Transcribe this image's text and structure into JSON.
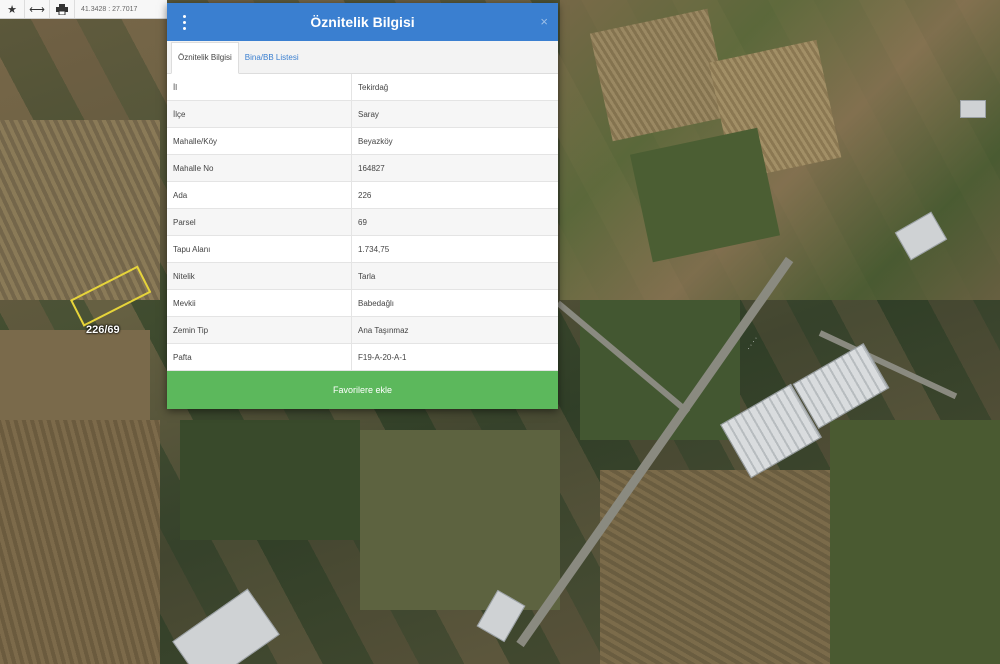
{
  "toolbar": {
    "icons": [
      "star-icon",
      "measure-icon",
      "print-icon"
    ],
    "coordinates": "41.3428 : 27.7017"
  },
  "dialog": {
    "title": "Öznitelik Bilgisi",
    "close_glyph": "×",
    "tabs": [
      {
        "label": "Öznitelik Bilgisi",
        "active": true
      },
      {
        "label": "Bina/BB Listesi",
        "active": false
      }
    ],
    "rows": [
      {
        "key": "İl",
        "value": "Tekirdağ"
      },
      {
        "key": "İlçe",
        "value": "Saray"
      },
      {
        "key": "Mahalle/Köy",
        "value": "Beyazköy"
      },
      {
        "key": "Mahalle No",
        "value": "164827"
      },
      {
        "key": "Ada",
        "value": "226"
      },
      {
        "key": "Parsel",
        "value": "69"
      },
      {
        "key": "Tapu Alanı",
        "value": "1.734,75"
      },
      {
        "key": "Nitelik",
        "value": "Tarla"
      },
      {
        "key": "Mevkii",
        "value": "Babedağlı"
      },
      {
        "key": "Zemin Tip",
        "value": "Ana Taşınmaz"
      },
      {
        "key": "Pafta",
        "value": "F19-A-20-A-1"
      }
    ],
    "favorite_button": "Favorilere ekle"
  },
  "map": {
    "parcel_label": "226/69"
  },
  "colors": {
    "header": "#3a7fd0",
    "favorite_button": "#5cb85c",
    "parcel_outline": "#e6d43a"
  }
}
